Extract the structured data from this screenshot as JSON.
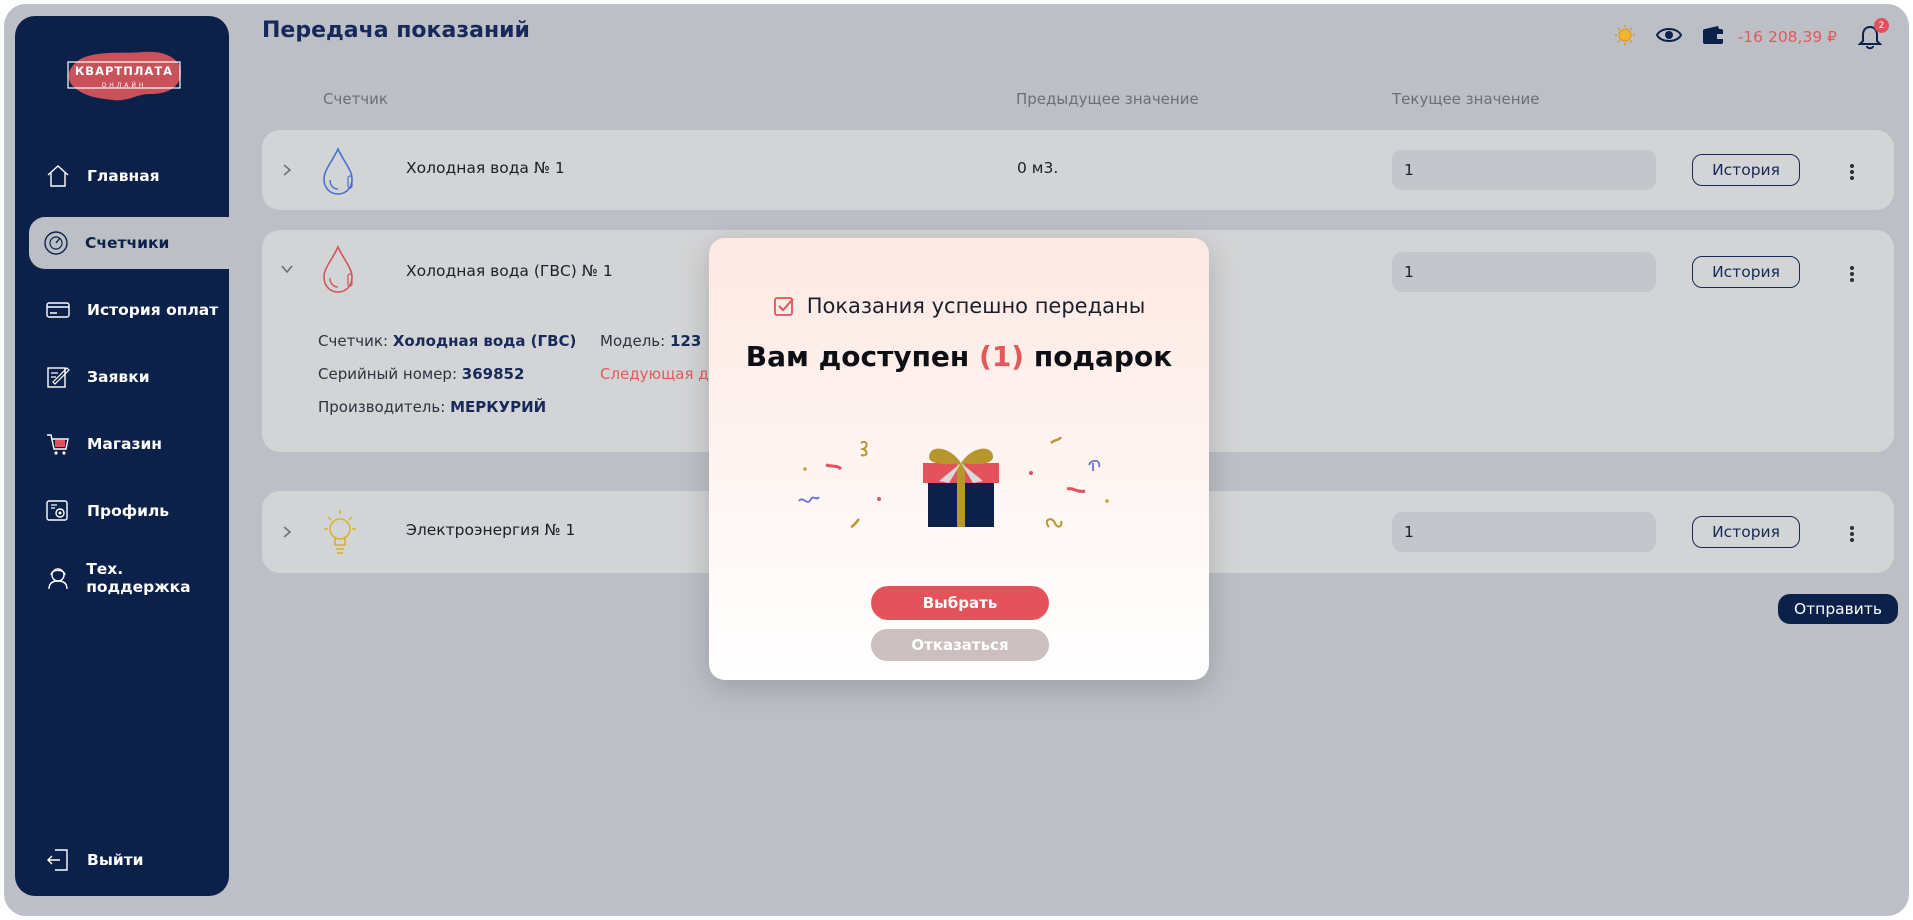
{
  "app": {
    "logo_text": "КВАРТПЛАТА",
    "logo_sub": "ОНЛАЙН"
  },
  "sidebar": {
    "items": [
      {
        "label": "Главная",
        "icon": "home-icon"
      },
      {
        "label": "Счетчики",
        "icon": "gauge-icon",
        "active": true
      },
      {
        "label": "История оплат",
        "icon": "card-icon"
      },
      {
        "label": "Заявки",
        "icon": "edit-icon"
      },
      {
        "label": "Магазин",
        "icon": "cart-icon"
      },
      {
        "label": "Профиль",
        "icon": "profile-gear-icon"
      },
      {
        "label": "Тех. поддержка",
        "icon": "support-icon"
      }
    ],
    "logout_label": "Выйти"
  },
  "header": {
    "title": "Передача показаний",
    "balance": "-16 208,39 ₽",
    "notifications_count": "2"
  },
  "table": {
    "headers": {
      "meter": "Счетчик",
      "previous": "Предыдущее значение",
      "current": "Текущее значение"
    },
    "rows": [
      {
        "name": "Холодная вода № 1",
        "previous": "0 м3.",
        "current": "1",
        "history_label": "История",
        "icon": "water-drop-blue-icon"
      },
      {
        "name": "Холодная вода (ГВС) № 1",
        "previous": "",
        "current": "1",
        "history_label": "История",
        "icon": "water-drop-red-icon"
      },
      {
        "name": "Электроэнергия № 1",
        "previous": "",
        "current": "1",
        "history_label": "История",
        "icon": "lightbulb-icon"
      }
    ],
    "details": {
      "meter_label": "Счетчик:",
      "meter_value": "Холодная вода (ГВС)",
      "model_label": "Модель:",
      "model_value": "123",
      "serial_label": "Серийный номер:",
      "serial_value": "369852",
      "next_date_partial": "Следующая да",
      "manufacturer_label": "Производитель:",
      "manufacturer_value": "МЕРКУРИЙ"
    },
    "send_label": "Отправить"
  },
  "modal": {
    "subtitle": "Показания успешно переданы",
    "title_before": "Вам доступен ",
    "title_count": "(1)",
    "title_after": " подарок",
    "choose_label": "Выбрать",
    "decline_label": "Отказаться"
  },
  "colors": {
    "sidebar_bg": "#0c2149",
    "accent_red": "#e4535b",
    "page_bg": "#bcc0c6"
  }
}
